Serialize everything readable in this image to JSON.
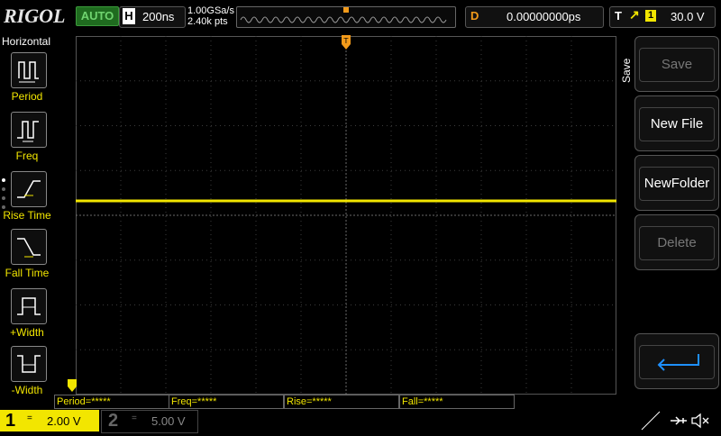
{
  "brand": "RIGOL",
  "top": {
    "run_mode": "AUTO",
    "horizontal_letter": "H",
    "timebase": "200ns",
    "sample_rate": "1.00GSa/s",
    "memory_depth": "2.40k pts",
    "delay_letter": "D",
    "delay": "0.00000000ps",
    "trigger_letter": "T",
    "trigger_source": "1",
    "trigger_level": "30.0 V"
  },
  "left_menu": {
    "title": "Horizontal",
    "items": [
      {
        "label": "Period",
        "icon": "period-icon"
      },
      {
        "label": "Freq",
        "icon": "freq-icon"
      },
      {
        "label": "Rise Time",
        "icon": "rise-time-icon"
      },
      {
        "label": "Fall Time",
        "icon": "fall-time-icon"
      },
      {
        "label": "+Width",
        "icon": "positive-width-icon"
      },
      {
        "label": "-Width",
        "icon": "negative-width-icon"
      }
    ]
  },
  "measurements": [
    {
      "text": "Period=*****"
    },
    {
      "text": "Freq=*****"
    },
    {
      "text": "Rise=*****"
    },
    {
      "text": "Fall=*****"
    }
  ],
  "channels": {
    "ch1": {
      "number": "1",
      "coupling": "=",
      "scale": "2.00 V"
    },
    "ch2": {
      "number": "2",
      "coupling": "=",
      "scale": "5.00 V"
    }
  },
  "right_menu": {
    "title": "Save",
    "buttons": [
      {
        "label": "Save",
        "enabled": false
      },
      {
        "label": "New File",
        "enabled": true
      },
      {
        "label": "NewFolder",
        "enabled": true
      },
      {
        "label": "Delete",
        "enabled": false
      }
    ],
    "back_icon": "return-arrow-icon"
  },
  "status_icons": [
    "usb-icon",
    "speaker-muted-icon",
    "arrows-icon"
  ],
  "colors": {
    "ch1": "#f2e600",
    "trigger": "#f29a1a",
    "auto_bg": "#1f6b1f"
  }
}
